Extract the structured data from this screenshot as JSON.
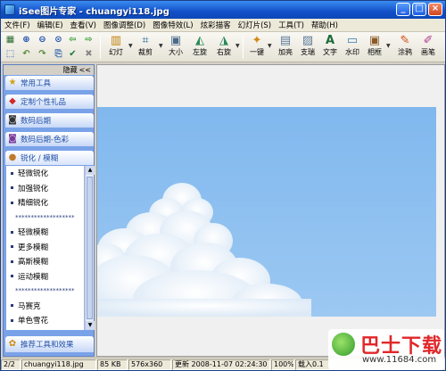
{
  "window": {
    "title": "iSee图片专家 - chuangyi118.jpg",
    "buttons": {
      "minimize": "_",
      "maximize": "□",
      "close": "×"
    }
  },
  "menu": [
    "文件(F)",
    "编辑(E)",
    "查看(V)",
    "图像调整(D)",
    "图像特效(L)",
    "炫彩描客",
    "幻灯片(S)",
    "工具(T)",
    "帮助(H)"
  ],
  "toolbar": {
    "buttons": [
      {
        "label": "幻灯",
        "icon": "slideshow-icon"
      },
      {
        "label": "裁剪",
        "icon": "crop-icon"
      },
      {
        "label": "大小",
        "icon": "resize-icon"
      },
      {
        "label": "左旋",
        "icon": "rotate-left-icon"
      },
      {
        "label": "右旋",
        "icon": "rotate-right-icon"
      },
      {
        "label": "一键",
        "icon": "one-click-icon"
      },
      {
        "label": "加亮",
        "icon": "brighten-icon"
      },
      {
        "label": "支瑞",
        "icon": "sharpen-icon"
      },
      {
        "label": "文字",
        "icon": "text-icon"
      },
      {
        "label": "水印",
        "icon": "watermark-icon"
      },
      {
        "label": "相框",
        "icon": "frame-icon"
      },
      {
        "label": "涂鸦",
        "icon": "doodle-icon"
      },
      {
        "label": "画笔",
        "icon": "brush-icon"
      }
    ]
  },
  "sidebar": {
    "hide_label": "隐藏",
    "collapse_glyph": "<<",
    "sections": [
      {
        "label": "常用工具",
        "icon": "star-icon"
      },
      {
        "label": "定制个性礼品",
        "icon": "gift-icon"
      },
      {
        "label": "数码后期",
        "icon": "camera-icon"
      },
      {
        "label": "数码后期-色彩",
        "icon": "palette-camera-icon"
      },
      {
        "label": "锐化 / 模糊",
        "icon": "sharpen-blur-icon"
      },
      {
        "label": "推荐工具和效果",
        "icon": "recommend-icon"
      }
    ],
    "items": [
      "轻微锐化",
      "加强锐化",
      "精细锐化",
      "*******************",
      "轻微模糊",
      "更多模糊",
      "高斯模糊",
      "运动模糊",
      "*******************",
      "马赛克",
      "单色雪花"
    ]
  },
  "status": {
    "index": "2/2",
    "filename": "chuangyi118.jpg",
    "size": "85 KB",
    "dimensions": "576x360",
    "modified": "更新 2008-11-07 02:24:30",
    "zoom": "100%",
    "load": "载入0.1"
  },
  "watermark": {
    "text": "巴士下载",
    "url": "www.11684.com"
  }
}
